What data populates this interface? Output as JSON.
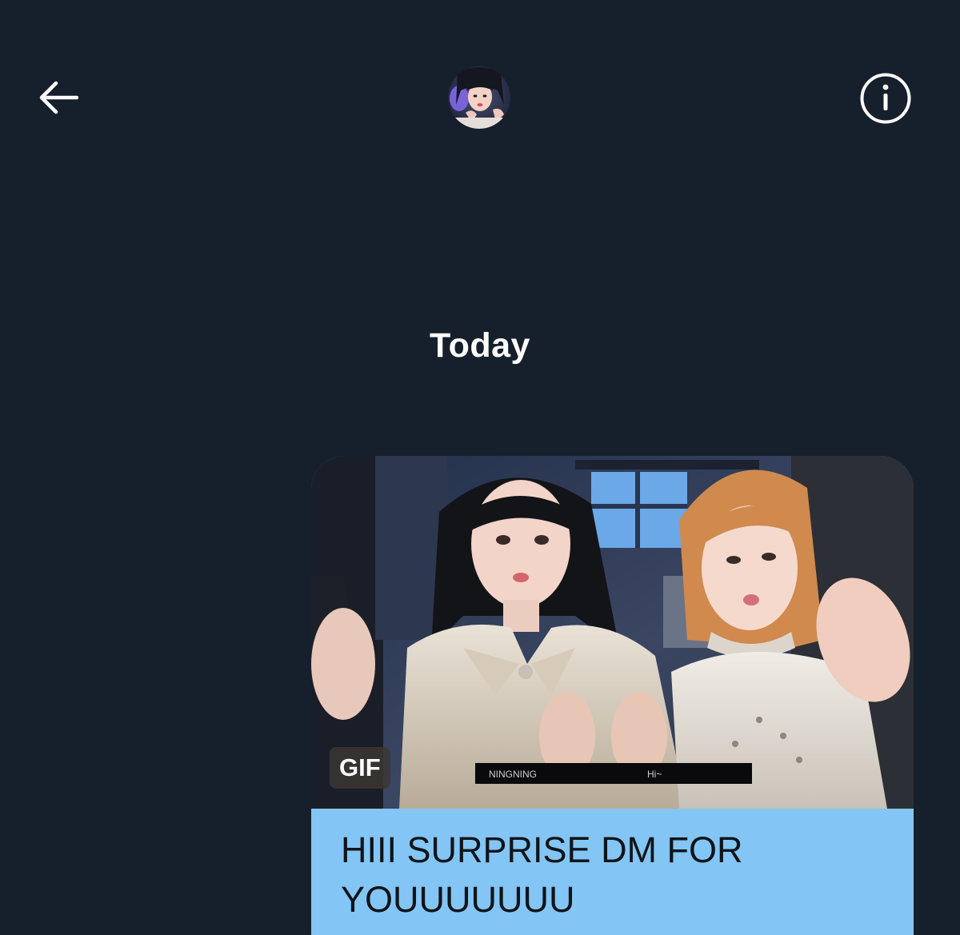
{
  "header": {
    "back_icon": "arrow-left-icon",
    "avatar_alt": "avatar",
    "info_icon": "info-circle-icon"
  },
  "conversation": {
    "date_separator": "Today",
    "message": {
      "media_badge": "GIF",
      "gif_caption_left": "NINGNING",
      "gif_caption_right": "Hi~",
      "text": "HIII SURPRISE DM FOR YOUUUUUUU",
      "bubble_color": "#83c5f4"
    }
  },
  "colors": {
    "background": "#16202c",
    "text": "#ffffff",
    "message_text": "#0f1419"
  }
}
